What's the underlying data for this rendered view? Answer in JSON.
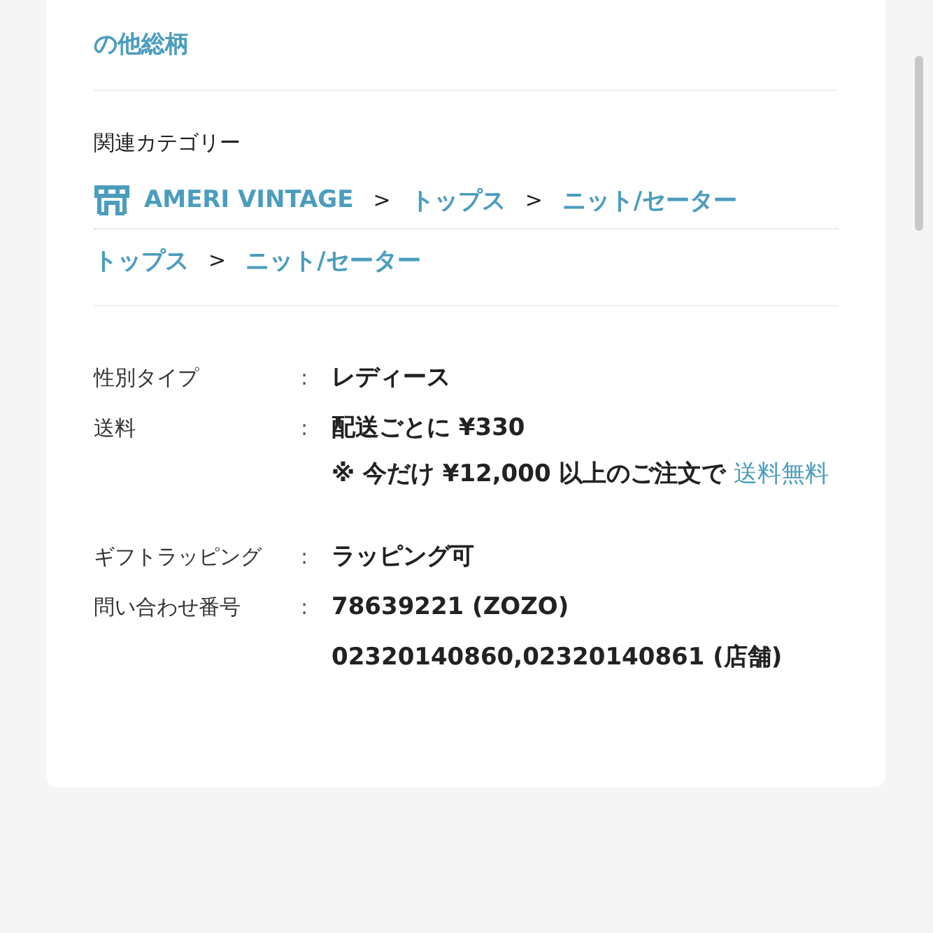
{
  "top_link": "の他総柄",
  "related_categories": {
    "heading": "関連カテゴリー",
    "paths": [
      {
        "links": [
          {
            "text": "AMERI VINTAGE",
            "kind": "shop"
          },
          {
            "text": "トップス",
            "kind": "category"
          },
          {
            "text": "ニット/セーター",
            "kind": "category"
          }
        ],
        "separators": [
          ">",
          ">"
        ]
      },
      {
        "links": [
          {
            "text": "トップス",
            "kind": "category"
          },
          {
            "text": "ニット/セーター",
            "kind": "category"
          }
        ],
        "separators": [
          ">"
        ]
      }
    ]
  },
  "specs": [
    {
      "label": "性別タイプ",
      "separator": ":",
      "values": [
        {
          "kind": "text",
          "text": "レディース"
        }
      ]
    },
    {
      "label": "送料",
      "separator": ":",
      "values": [
        {
          "kind": "text",
          "text": "配送ごとに ¥330"
        },
        {
          "kind": "note",
          "text": "※ 今だけ ¥12,000 以上のご注文で",
          "link": "送料無料"
        }
      ]
    },
    {
      "label": "ギフトラッピング",
      "separator": ":",
      "values": [
        {
          "kind": "text",
          "text": "ラッピング可"
        }
      ]
    },
    {
      "label": "問い合わせ番号",
      "separator": ":",
      "values": [
        {
          "kind": "text",
          "text": "78639221 (ZOZO)"
        },
        {
          "kind": "text",
          "text": "02320140860,02320140861 (店舗)"
        }
      ]
    }
  ]
}
